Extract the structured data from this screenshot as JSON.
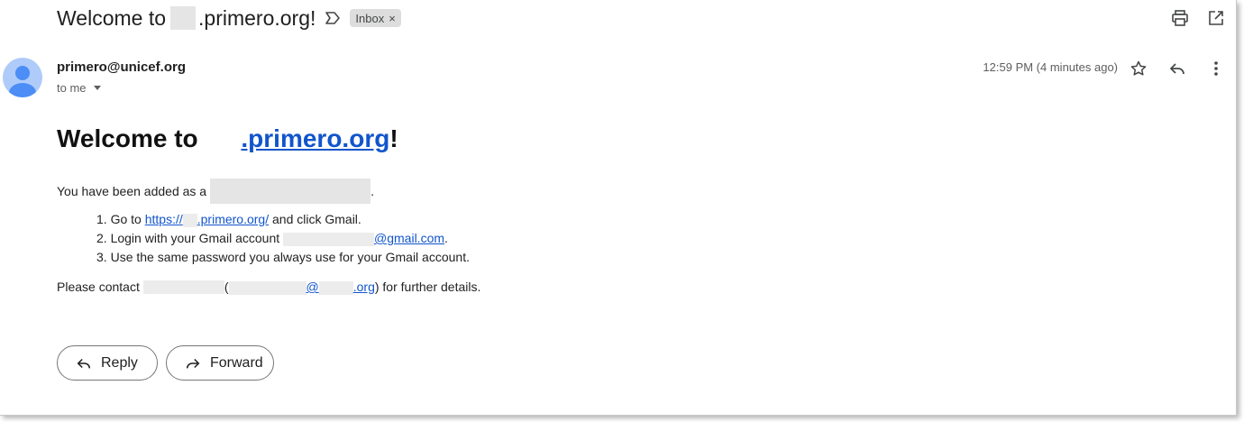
{
  "subject": {
    "prefix": "Welcome to",
    "suffix": ".primero.org!"
  },
  "labels": {
    "inbox": "Inbox",
    "inbox_remove": "×"
  },
  "sender": {
    "email": "primero@unicef.org",
    "recipient": "to me"
  },
  "timestamp": "12:59 PM (4 minutes ago)",
  "body": {
    "headline_prefix": "Welcome to ",
    "headline_link": ".primero.org",
    "headline_end": "!",
    "added_as": "You have been added as a",
    "added_end": ".",
    "steps": [
      {
        "num": "1.",
        "pre": "Go to ",
        "link": "https://",
        "link_rest": ".primero.org/",
        "post": " and click Gmail."
      },
      {
        "num": "2.",
        "pre": "Login with your Gmail account ",
        "link": "@gmail.com",
        "post": "."
      },
      {
        "num": "3.",
        "pre": "Use the same password you always use for your Gmail account."
      }
    ],
    "contact_pre": "Please contact",
    "contact_paren_open": " (",
    "contact_at": "@",
    "contact_domain": ".org",
    "contact_post": ") for further details."
  },
  "buttons": {
    "reply": "Reply",
    "forward": "Forward"
  },
  "icons": {
    "important": "label-important-icon",
    "print": "print-icon",
    "open_new": "open-in-new-window-icon",
    "star": "star-icon",
    "reply": "reply-icon",
    "more": "more-vertical-icon",
    "forward": "forward-icon"
  },
  "colors": {
    "link": "#1155cc",
    "avatar_bg": "#aecbfa",
    "avatar_fg": "#4c8df6",
    "chip_bg": "#dddddd"
  }
}
